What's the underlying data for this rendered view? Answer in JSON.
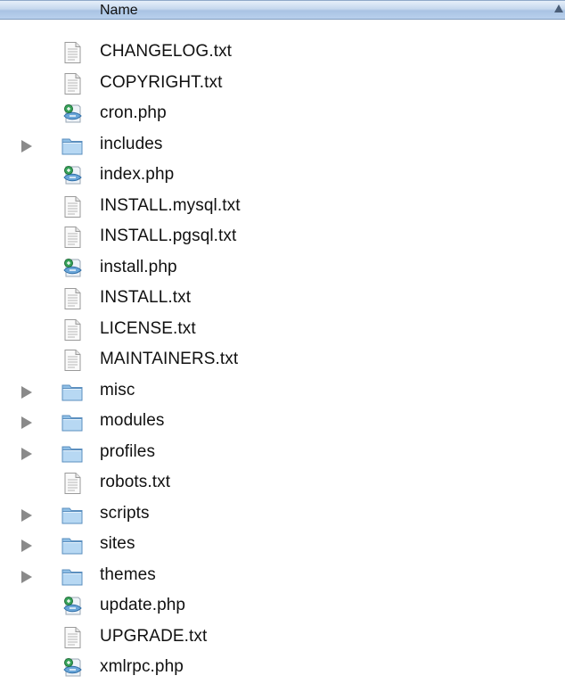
{
  "header": {
    "column_name": "Name"
  },
  "files": [
    {
      "name": "CHANGELOG.txt",
      "kind": "text",
      "icon": "text-document-icon",
      "expandable": false
    },
    {
      "name": "COPYRIGHT.txt",
      "kind": "text",
      "icon": "text-document-icon",
      "expandable": false
    },
    {
      "name": "cron.php",
      "kind": "php",
      "icon": "php-script-icon",
      "expandable": false
    },
    {
      "name": "includes",
      "kind": "folder",
      "icon": "folder-icon",
      "expandable": true
    },
    {
      "name": "index.php",
      "kind": "php",
      "icon": "php-script-icon",
      "expandable": false
    },
    {
      "name": "INSTALL.mysql.txt",
      "kind": "text",
      "icon": "text-document-icon",
      "expandable": false
    },
    {
      "name": "INSTALL.pgsql.txt",
      "kind": "text",
      "icon": "text-document-icon",
      "expandable": false
    },
    {
      "name": "install.php",
      "kind": "php",
      "icon": "php-script-icon",
      "expandable": false
    },
    {
      "name": "INSTALL.txt",
      "kind": "text",
      "icon": "text-document-icon",
      "expandable": false
    },
    {
      "name": "LICENSE.txt",
      "kind": "text",
      "icon": "text-document-icon",
      "expandable": false
    },
    {
      "name": "MAINTAINERS.txt",
      "kind": "text",
      "icon": "text-document-icon",
      "expandable": false
    },
    {
      "name": "misc",
      "kind": "folder",
      "icon": "folder-icon",
      "expandable": true
    },
    {
      "name": "modules",
      "kind": "folder",
      "icon": "folder-icon",
      "expandable": true
    },
    {
      "name": "profiles",
      "kind": "folder",
      "icon": "folder-icon",
      "expandable": true
    },
    {
      "name": "robots.txt",
      "kind": "text",
      "icon": "text-document-icon",
      "expandable": false
    },
    {
      "name": "scripts",
      "kind": "folder",
      "icon": "folder-icon",
      "expandable": true
    },
    {
      "name": "sites",
      "kind": "folder",
      "icon": "folder-icon",
      "expandable": true
    },
    {
      "name": "themes",
      "kind": "folder",
      "icon": "folder-icon",
      "expandable": true
    },
    {
      "name": "update.php",
      "kind": "php",
      "icon": "php-script-icon",
      "expandable": false
    },
    {
      "name": "UPGRADE.txt",
      "kind": "text",
      "icon": "text-document-icon",
      "expandable": false
    },
    {
      "name": "xmlrpc.php",
      "kind": "php",
      "icon": "php-script-icon",
      "expandable": false
    }
  ]
}
